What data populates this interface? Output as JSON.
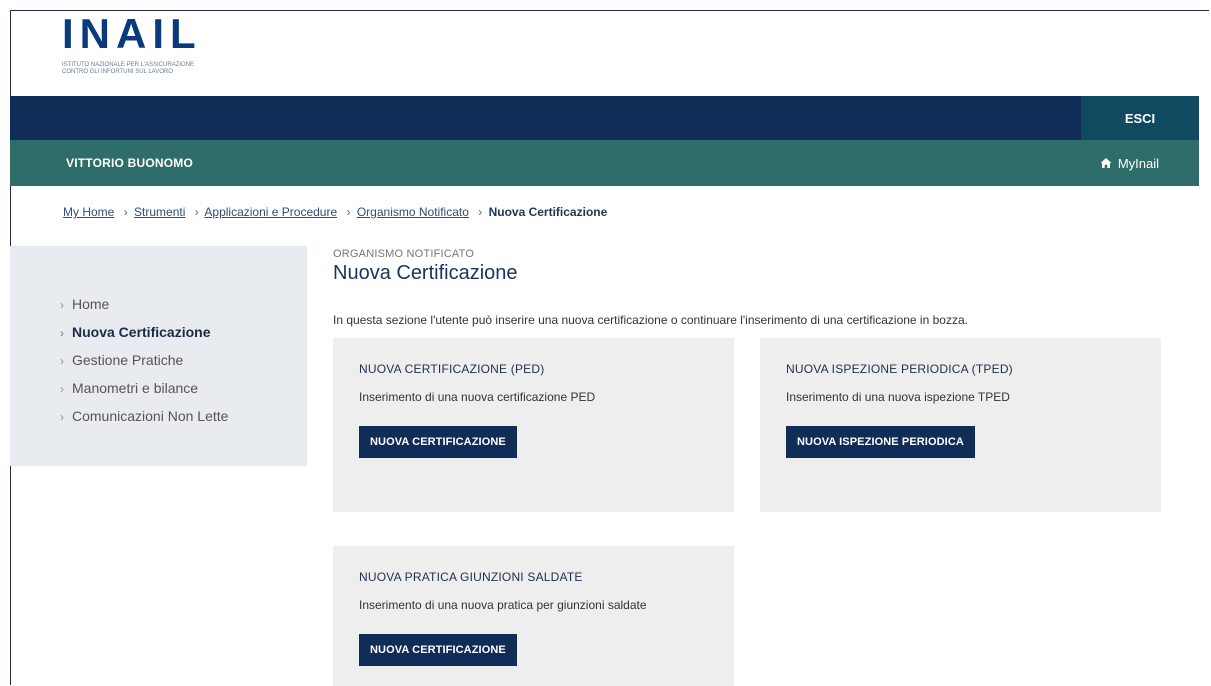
{
  "brand": {
    "logo_text": "INAIL",
    "tagline_line1": "ISTITUTO NAZIONALE PER L'ASSICURAZIONE",
    "tagline_line2": "CONTRO GLI INFORTUNI SUL LAVORO"
  },
  "topbar": {
    "logout_label": "ESCI"
  },
  "userbar": {
    "user_name": "VITTORIO BUONOMO",
    "myinail_label": "MyInail",
    "myinail_icon": "home-icon"
  },
  "breadcrumb": {
    "items": [
      "My Home",
      "Strumenti",
      "Applicazioni e Procedure",
      "Organismo Notificato"
    ],
    "current": "Nuova Certificazione",
    "separator": "›"
  },
  "sidebar": {
    "items": [
      {
        "label": "Home",
        "active": false
      },
      {
        "label": "Nuova Certificazione",
        "active": true
      },
      {
        "label": "Gestione Pratiche",
        "active": false
      },
      {
        "label": "Manometri e bilance",
        "active": false
      },
      {
        "label": "Comunicazioni Non Lette",
        "active": false
      }
    ]
  },
  "main": {
    "section_label": "ORGANISMO NOTIFICATO",
    "title": "Nuova Certificazione",
    "intro": "In questa sezione l'utente può inserire una nuova certificazione o continuare l'inserimento di una certificazione in bozza.",
    "cards": [
      {
        "title": "NUOVA CERTIFICAZIONE (PED)",
        "description": "Inserimento di una nuova certificazione PED",
        "button": "NUOVA CERTIFICAZIONE"
      },
      {
        "title": "NUOVA ISPEZIONE PERIODICA (TPED)",
        "description": "Inserimento di una nuova ispezione TPED",
        "button": "NUOVA ISPEZIONE PERIODICA"
      },
      {
        "title": "NUOVA PRATICA GIUNZIONI SALDATE",
        "description": "Inserimento di una nuova pratica per giunzioni saldate",
        "button": "NUOVA CERTIFICAZIONE"
      }
    ]
  },
  "colors": {
    "navy": "#0f2d56",
    "teal": "#2e6d6a",
    "card_bg": "#eeeeee",
    "sidebar_bg": "#e8ebf0"
  }
}
